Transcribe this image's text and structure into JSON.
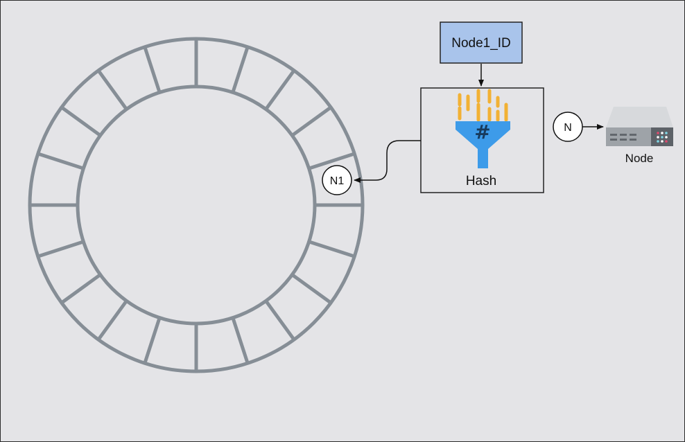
{
  "input_box": {
    "label": "Node1_ID",
    "fill": "#a9c4eb",
    "stroke": "#222222"
  },
  "hash_box": {
    "label": "Hash",
    "icon": "hash-funnel-icon"
  },
  "ring": {
    "segments": 20,
    "stroke": "#868e96"
  },
  "ring_marker": {
    "label": "N1"
  },
  "node_marker": {
    "label": "N"
  },
  "node": {
    "label": "Node",
    "icon": "server-icon"
  },
  "colors": {
    "funnel_blue": "#3d9be9",
    "funnel_bars": "#f2b134",
    "server_body": "#9ea3a8",
    "server_top": "#d7d9dc"
  }
}
